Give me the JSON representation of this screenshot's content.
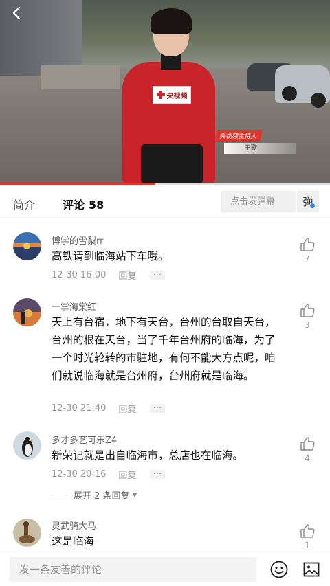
{
  "video": {
    "mic_logo": "央视频",
    "lower_third_tag": "央视频主持人",
    "lower_third_name": "王歌",
    "progress": 0.47
  },
  "tabs": {
    "intro": "简介",
    "comments": "评论",
    "comments_count": "58",
    "danmaku_placeholder": "点击发弹幕",
    "danmaku_button": "弹"
  },
  "comments": [
    {
      "user": "博学的雪梨rr",
      "text": "高铁请到临海站下车哦。",
      "time": "12-30 16:00",
      "reply": "回复",
      "likes": "7"
    },
    {
      "user": "一掌海棠红",
      "text": "天上有台宿，地下有天台，台州的台取自天台，台州的根在天台，当了千年台州府的临海，为了一个时光轮转的市驻地，有何不能大方点呢，咱们就说临海就是台州府，台州府就是临海。",
      "time": "12-30 21:40",
      "reply": "回复",
      "likes": "3"
    },
    {
      "user": "多才多艺可乐Z4",
      "text": "新荣记就是出自临海市，总店也在临海。",
      "time": "12-30 20:16",
      "reply": "回复",
      "likes": "4",
      "expand": "展开 2 条回复"
    },
    {
      "user": "灵武骑大马",
      "text": "这是临海",
      "likes": "1"
    }
  ],
  "bottom": {
    "input_placeholder": "发一条友善的评论"
  },
  "colors": {
    "accent": "#e8322a",
    "text_muted": "#999999"
  }
}
